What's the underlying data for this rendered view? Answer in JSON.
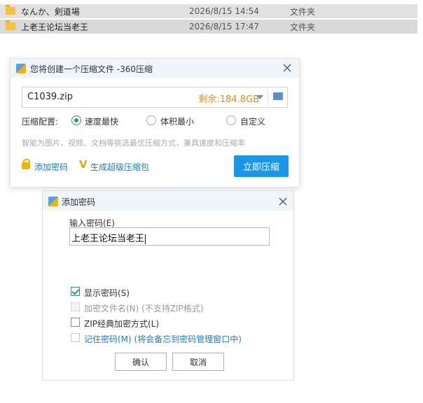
{
  "explorer": {
    "rows": [
      {
        "name": "なんか、剣道場",
        "date": "2026/8/15 14:54",
        "type": "文件夹"
      },
      {
        "name": "上老王论坛当老王",
        "date": "2026/8/15 17:47",
        "type": "文件夹"
      }
    ]
  },
  "compress_dialog": {
    "title": "您将创建一个压缩文件 -360压缩",
    "filename": "C1039.zip",
    "free_space": "剩余:184.8GB",
    "config_label": "压缩配置:",
    "options": [
      {
        "label": "速度最快",
        "selected": true
      },
      {
        "label": "体积最小",
        "selected": false
      },
      {
        "label": "自定义",
        "selected": false
      }
    ],
    "hint": "智能为图片、视频、文档等挑选最优压缩方式，兼具速度和压缩率",
    "add_password_link": "添加密码",
    "super_pack_link": "生成超级压缩包",
    "compress_button": "立即压缩"
  },
  "password_dialog": {
    "title": "添加密码",
    "input_label": "输入密码(E)",
    "password_value": "上老王论坛当老王",
    "checkboxes": [
      {
        "label": "显示密码(S)",
        "checked": true,
        "disabled": false
      },
      {
        "label": "加密文件名(N) (不支持ZIP格式)",
        "checked": false,
        "disabled": true
      },
      {
        "label": "ZIP经典加密方式(L)",
        "checked": false,
        "disabled": false
      },
      {
        "label": "记住密码(M) (将会备忘到密码管理窗口中)",
        "checked": false,
        "disabled": false
      }
    ],
    "ok_button": "确认",
    "cancel_button": "取消"
  },
  "colors": {
    "accent": "#1b96e8",
    "check_green": "#2a9d6a",
    "space_orange": "#e58a1f",
    "link_blue": "#1a7dc4"
  }
}
